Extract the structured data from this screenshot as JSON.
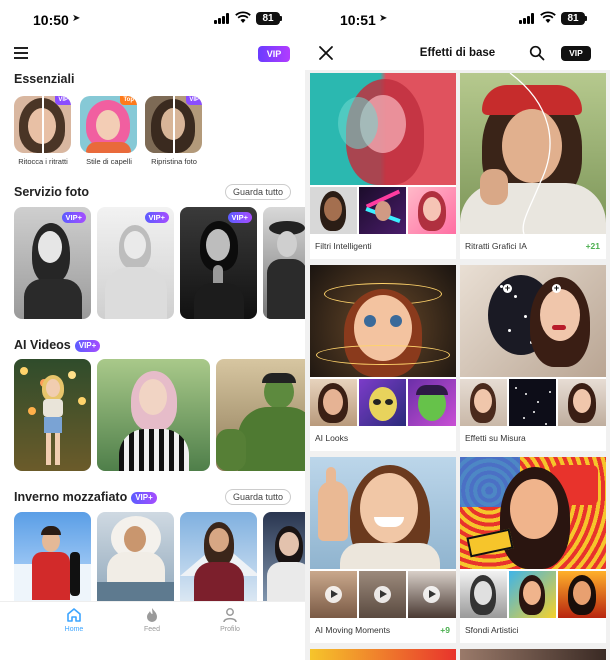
{
  "left": {
    "status": {
      "time": "10:50",
      "battery": "81"
    },
    "header": {
      "vip_label": "VIP"
    },
    "essentials": {
      "title": "Essenziali",
      "items": [
        {
          "label": "Ritocca i ritratti",
          "tag": "VIP"
        },
        {
          "label": "Stile di capelli",
          "tag": "Top"
        },
        {
          "label": "Ripristina foto",
          "tag": "VIP"
        }
      ]
    },
    "photo_service": {
      "title": "Servizio foto",
      "see_all": "Guarda tutto",
      "cards": [
        {
          "tag": "VIP+"
        },
        {
          "tag": "VIP+"
        },
        {
          "tag": "VIP+"
        },
        {
          "tag": ""
        }
      ]
    },
    "ai_videos": {
      "title": "AI Videos",
      "tag": "VIP+"
    },
    "winter": {
      "title": "Inverno mozzafiato",
      "tag": "VIP+",
      "see_all": "Guarda tutto"
    },
    "nav": [
      {
        "label": "Home",
        "icon": "home-icon",
        "active": true
      },
      {
        "label": "Feed",
        "icon": "flame-icon",
        "active": false
      },
      {
        "label": "Profilo",
        "icon": "person-icon",
        "active": false
      }
    ],
    "colors": {
      "accent": "#3da5ff",
      "vip_gradient_start": "#6a3cff",
      "vip_gradient_end": "#b23cff"
    }
  },
  "right": {
    "status": {
      "time": "10:51",
      "battery": "81"
    },
    "header": {
      "title": "Effetti di base",
      "vip_label": "VIP"
    },
    "effects": [
      {
        "label": "Filtri Intelligenti",
        "count": ""
      },
      {
        "label": "Ritratti Grafici IA",
        "count": "+21"
      },
      {
        "label": "AI Looks",
        "count": ""
      },
      {
        "label": "Effetti su Misura",
        "count": ""
      },
      {
        "label": "AI Moving Moments",
        "count": "+9"
      },
      {
        "label": "Sfondi Artistici",
        "count": ""
      }
    ]
  }
}
